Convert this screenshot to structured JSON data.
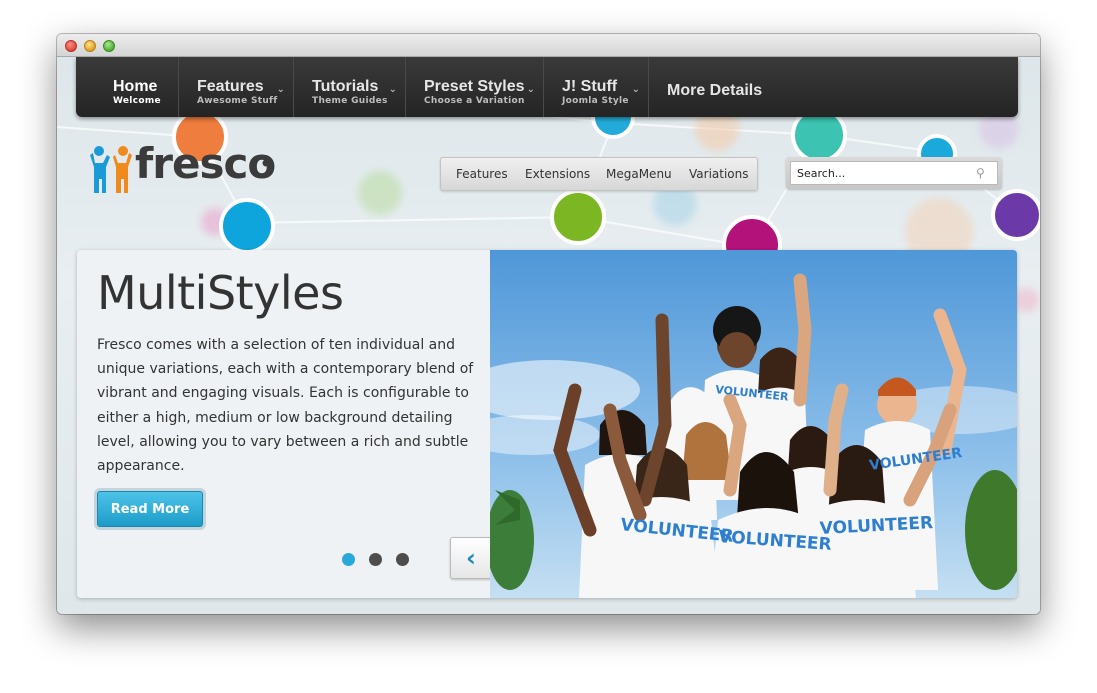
{
  "nav": {
    "items": [
      {
        "title": "Home",
        "subtitle": "Welcome"
      },
      {
        "title": "Features",
        "subtitle": "Awesome Stuff"
      },
      {
        "title": "Tutorials",
        "subtitle": "Theme Guides"
      },
      {
        "title": "Preset Styles",
        "subtitle": "Choose a Variation"
      },
      {
        "title": "J! Stuff",
        "subtitle": "Joomla Style"
      },
      {
        "title": "More Details"
      }
    ]
  },
  "logo": {
    "text": "fresco"
  },
  "subnav": {
    "items": [
      "Features",
      "Extensions",
      "MegaMenu",
      "Variations"
    ]
  },
  "search": {
    "placeholder": "Search..."
  },
  "slide": {
    "title": "MultiStyles",
    "text": "Fresco comes with a selection of ten individual and unique variations, each with a contemporary blend of vibrant and engaging visuals. Each is configurable to either a high, medium or low background detailing level, allowing you to vary between a rich and subtle appearance.",
    "button": "Read More",
    "active_dot": 1,
    "dot_count": 3,
    "photo_text": "VOLUNTEER"
  },
  "colors": {
    "accent": "#1e9fd0",
    "nav_bg": "#2e2e2e",
    "dot_active": "#29a8dc",
    "dot_inactive": "#4d4d4d"
  },
  "icons": {
    "search": "magnifier-icon",
    "prev": "chevron-left-icon",
    "next": "chevron-right-icon"
  }
}
